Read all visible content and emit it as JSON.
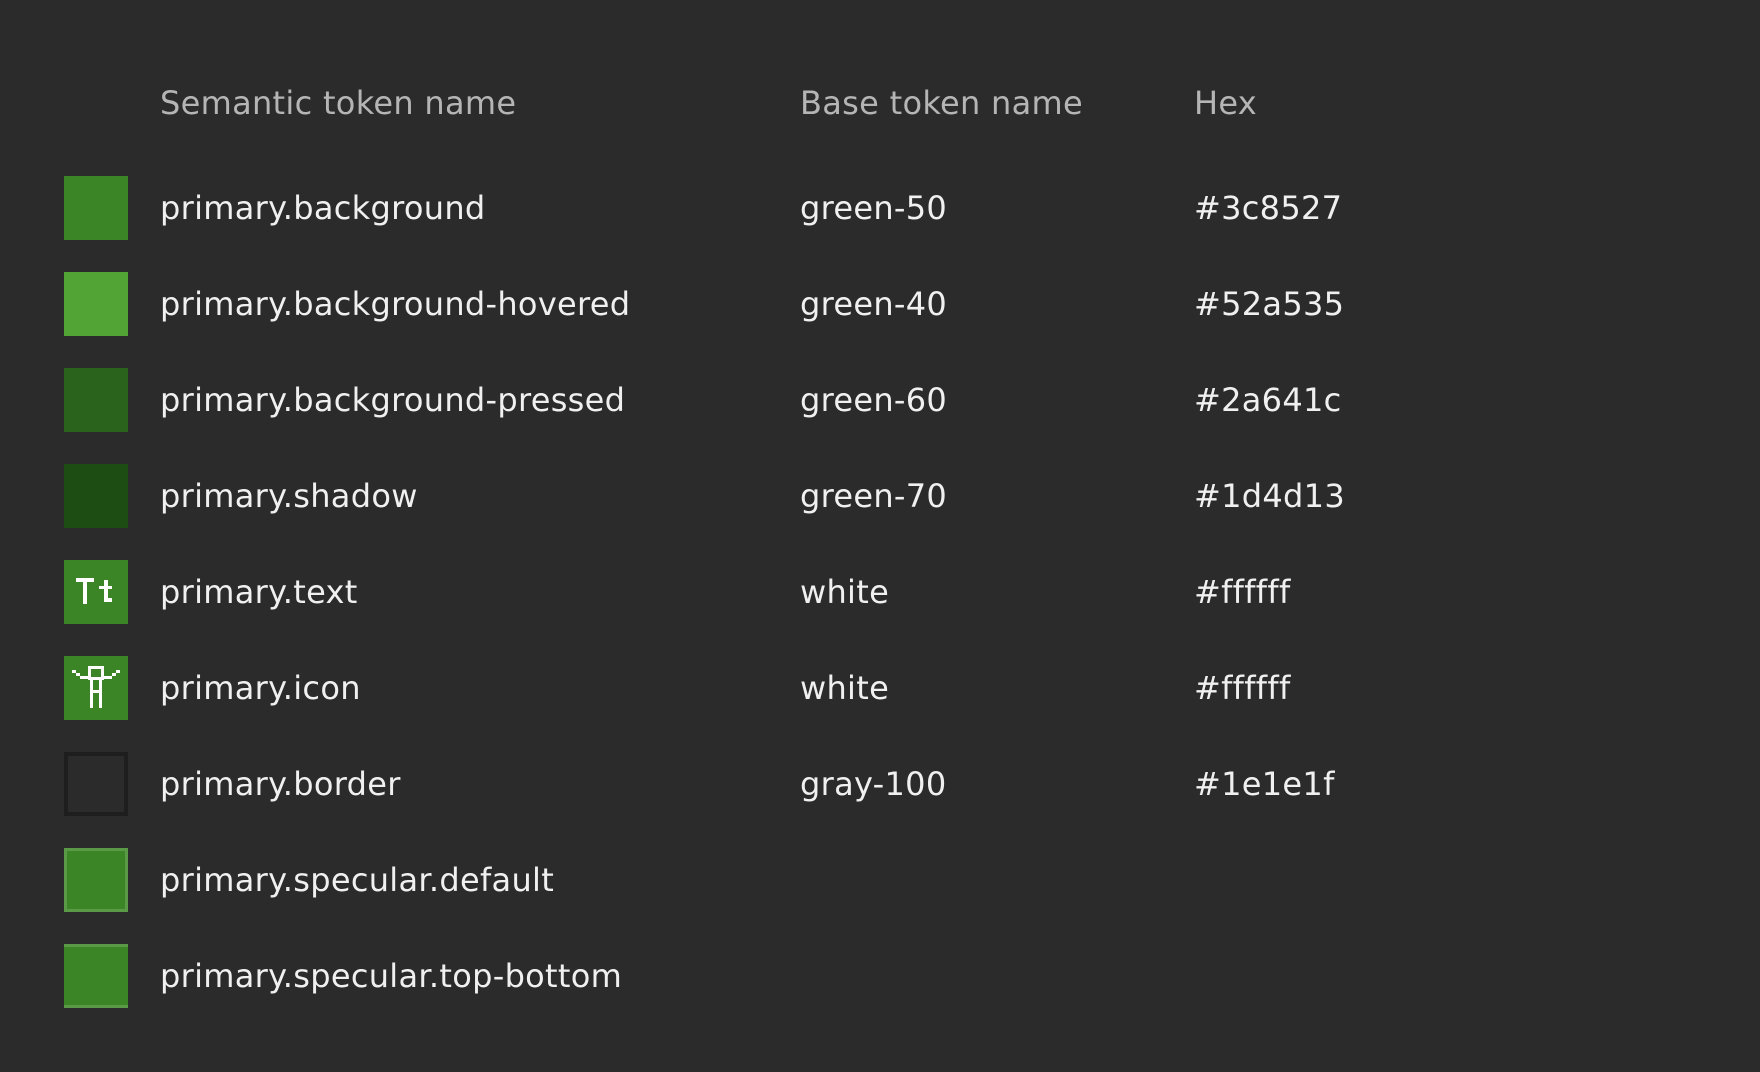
{
  "headers": {
    "semantic": "Semantic token name",
    "base": "Base token name",
    "hex": "Hex"
  },
  "rows": [
    {
      "semantic": "primary.background",
      "base": "green-50",
      "hex": "#3c8527",
      "swatch_color": "#3c8527"
    },
    {
      "semantic": "primary.background-hovered",
      "base": "green-40",
      "hex": "#52a535",
      "swatch_color": "#52a535"
    },
    {
      "semantic": "primary.background-pressed",
      "base": "green-60",
      "hex": "#2a641c",
      "swatch_color": "#2a641c"
    },
    {
      "semantic": "primary.shadow",
      "base": "green-70",
      "hex": "#1d4d13",
      "swatch_color": "#1d4d13"
    },
    {
      "semantic": "primary.text",
      "base": "white",
      "hex": "#ffffff",
      "swatch_color": "#3c8527",
      "swatch_icon": "text-glyph-icon"
    },
    {
      "semantic": "primary.icon",
      "base": "white",
      "hex": "#ffffff",
      "swatch_color": "#3c8527",
      "swatch_icon": "pixel-figure-icon"
    },
    {
      "semantic": "primary.border",
      "base": "gray-100",
      "hex": "#1e1e1f",
      "swatch_color": "#2b2b2b",
      "swatch_border": "#1e1e1f"
    },
    {
      "semantic": "primary.specular.default",
      "base": "",
      "hex": "",
      "swatch_color": "#3c8527",
      "swatch_border": "#5a9a46"
    },
    {
      "semantic": "primary.specular.top-bottom",
      "base": "",
      "hex": "",
      "swatch_color": "#3c8527",
      "swatch_border_top_bottom": "#5a9a46"
    }
  ]
}
